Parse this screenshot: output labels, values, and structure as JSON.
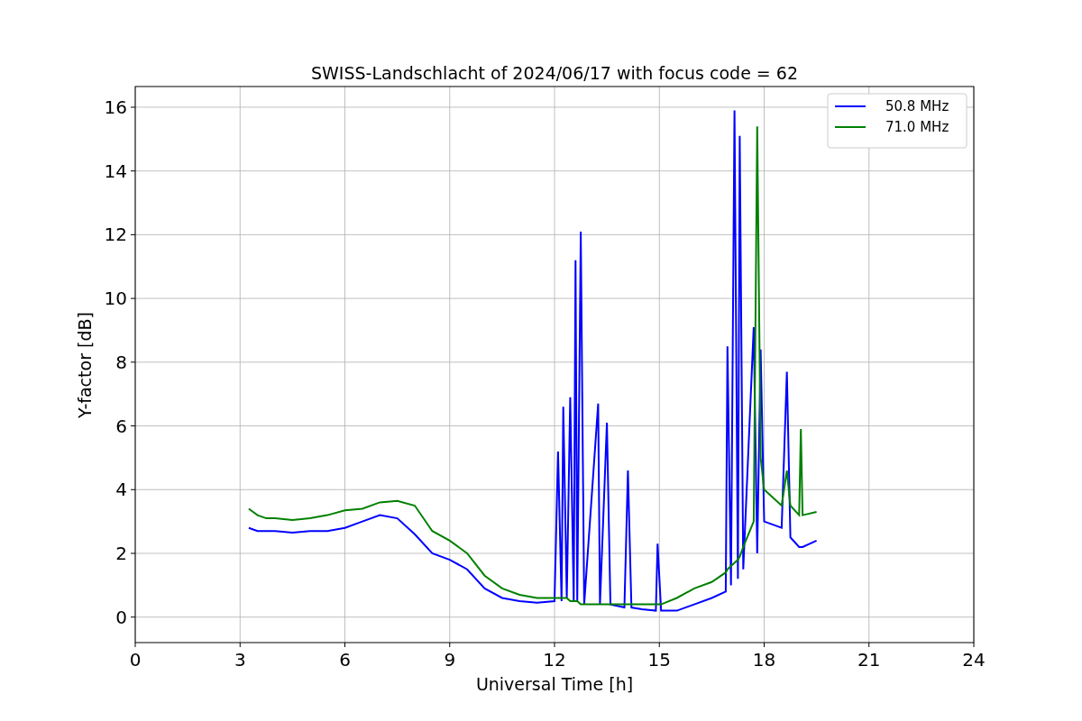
{
  "figure": {
    "chart_data": {
      "type": "line",
      "title": "SWISS-Landschlacht of 2024/06/17 with focus code = 62",
      "xlabel": "Universal Time [h]",
      "ylabel": "Y-factor [dB]",
      "x": [
        3.25,
        3.5,
        3.75,
        4,
        4.5,
        5,
        5.5,
        6,
        6.5,
        7,
        7.5,
        8,
        8.5,
        9,
        9.5,
        10,
        10.5,
        11,
        11.5,
        12,
        12.1,
        12.2,
        12.25,
        12.35,
        12.45,
        12.55,
        12.6,
        12.65,
        12.75,
        12.85,
        13.25,
        13.3,
        13.5,
        13.6,
        14,
        14.1,
        14.2,
        14.5,
        14.9,
        14.95,
        15.05,
        15.5,
        16,
        16.5,
        16.9,
        16.95,
        17.05,
        17.15,
        17.25,
        17.3,
        17.4,
        17.7,
        17.8,
        17.9,
        18,
        18.5,
        18.65,
        18.75,
        19,
        19.05,
        19.1,
        19.5
      ],
      "series": [
        {
          "name": "50.8 MHz",
          "color": "#0000ff",
          "values": [
            2.8,
            2.7,
            2.7,
            2.7,
            2.65,
            2.7,
            2.7,
            2.8,
            3.0,
            3.2,
            3.1,
            2.6,
            2.0,
            1.8,
            1.5,
            0.9,
            0.6,
            0.5,
            0.45,
            0.5,
            5.2,
            0.5,
            6.6,
            0.6,
            6.9,
            0.5,
            11.2,
            0.5,
            12.1,
            0.4,
            6.7,
            0.4,
            6.1,
            0.4,
            0.3,
            4.6,
            0.3,
            0.25,
            0.2,
            2.3,
            0.2,
            0.2,
            0.4,
            0.6,
            0.8,
            8.5,
            1.0,
            15.9,
            1.2,
            15.1,
            1.5,
            9.1,
            2.0,
            8.4,
            3.0,
            2.8,
            7.7,
            2.5,
            2.2,
            2.2,
            2.2,
            2.4
          ]
        },
        {
          "name": "71.0 MHz",
          "color": "#008000",
          "values": [
            3.4,
            3.2,
            3.1,
            3.1,
            3.05,
            3.1,
            3.2,
            3.35,
            3.4,
            3.6,
            3.65,
            3.5,
            2.7,
            2.4,
            2.0,
            1.3,
            0.9,
            0.7,
            0.6,
            0.6,
            0.6,
            0.6,
            0.6,
            0.6,
            0.5,
            0.5,
            0.5,
            0.5,
            0.4,
            0.4,
            0.4,
            0.4,
            0.4,
            0.4,
            0.4,
            0.4,
            0.4,
            0.4,
            0.4,
            0.4,
            0.4,
            0.6,
            0.9,
            1.1,
            1.4,
            1.5,
            1.6,
            1.7,
            1.8,
            1.9,
            2.2,
            3.0,
            15.4,
            5.0,
            4.0,
            3.5,
            4.6,
            3.5,
            3.2,
            5.9,
            3.2,
            3.3
          ]
        }
      ],
      "grid": true,
      "legend": true,
      "xlim": [
        0,
        24
      ],
      "ylim": [
        -0.8,
        16.65
      ],
      "xticks": [
        0,
        3,
        6,
        9,
        12,
        15,
        18,
        21,
        24
      ],
      "yticks": [
        0,
        2,
        4,
        6,
        8,
        10,
        12,
        14,
        16
      ]
    }
  }
}
